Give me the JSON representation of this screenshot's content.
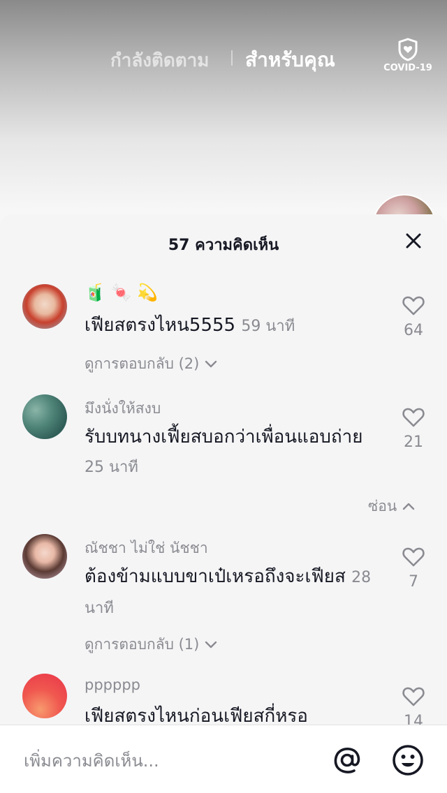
{
  "feed": {
    "tab_following": "กำลังติดตาม",
    "tab_for_you": "สำหรับคุณ",
    "covid_label": "COVID-19"
  },
  "comments_sheet": {
    "title": "57 ความคิดเห็น",
    "comments": [
      {
        "username_emoji": "🧃 🍬 💫",
        "text": "เฟียสตรงไหน5555",
        "time": "59 นาที",
        "likes": "64",
        "replies_label": "ดูการตอบกลับ (2)"
      },
      {
        "username": "มึงนั่งให้สงบ",
        "text": "รับบทนางเฟี้ยสบอกว่าเพื่อนแอบถ่าย",
        "time": "25 นาที",
        "likes": "21",
        "hide_label": "ซ่อน"
      },
      {
        "username": "ณัชชา ไม่ใช่ นัชชา",
        "text": "ต้องข้ามแบบขาเป๋เหรอถึงจะเฟียส",
        "time": "28 นาที",
        "likes": "7",
        "replies_label": "ดูการตอบกลับ (1)"
      },
      {
        "username": "pppppp",
        "text": "เฟียสตรงไหนก่อนเฟียสกี่หรอ",
        "likes": "14"
      }
    ]
  },
  "input": {
    "placeholder": "เพิ่มความคิดเห็น..."
  },
  "icons": {
    "heart": "heart-icon",
    "close": "close-icon",
    "at": "at-sign-icon",
    "emoji": "smiley-icon",
    "covid": "shield-heart-icon",
    "chevron_down": "chevron-down-icon",
    "chevron_up": "chevron-up-icon"
  },
  "colors": {
    "text_primary": "#161823",
    "text_secondary": "#8a8b91",
    "sheet_bg": "#f5f5f6"
  }
}
